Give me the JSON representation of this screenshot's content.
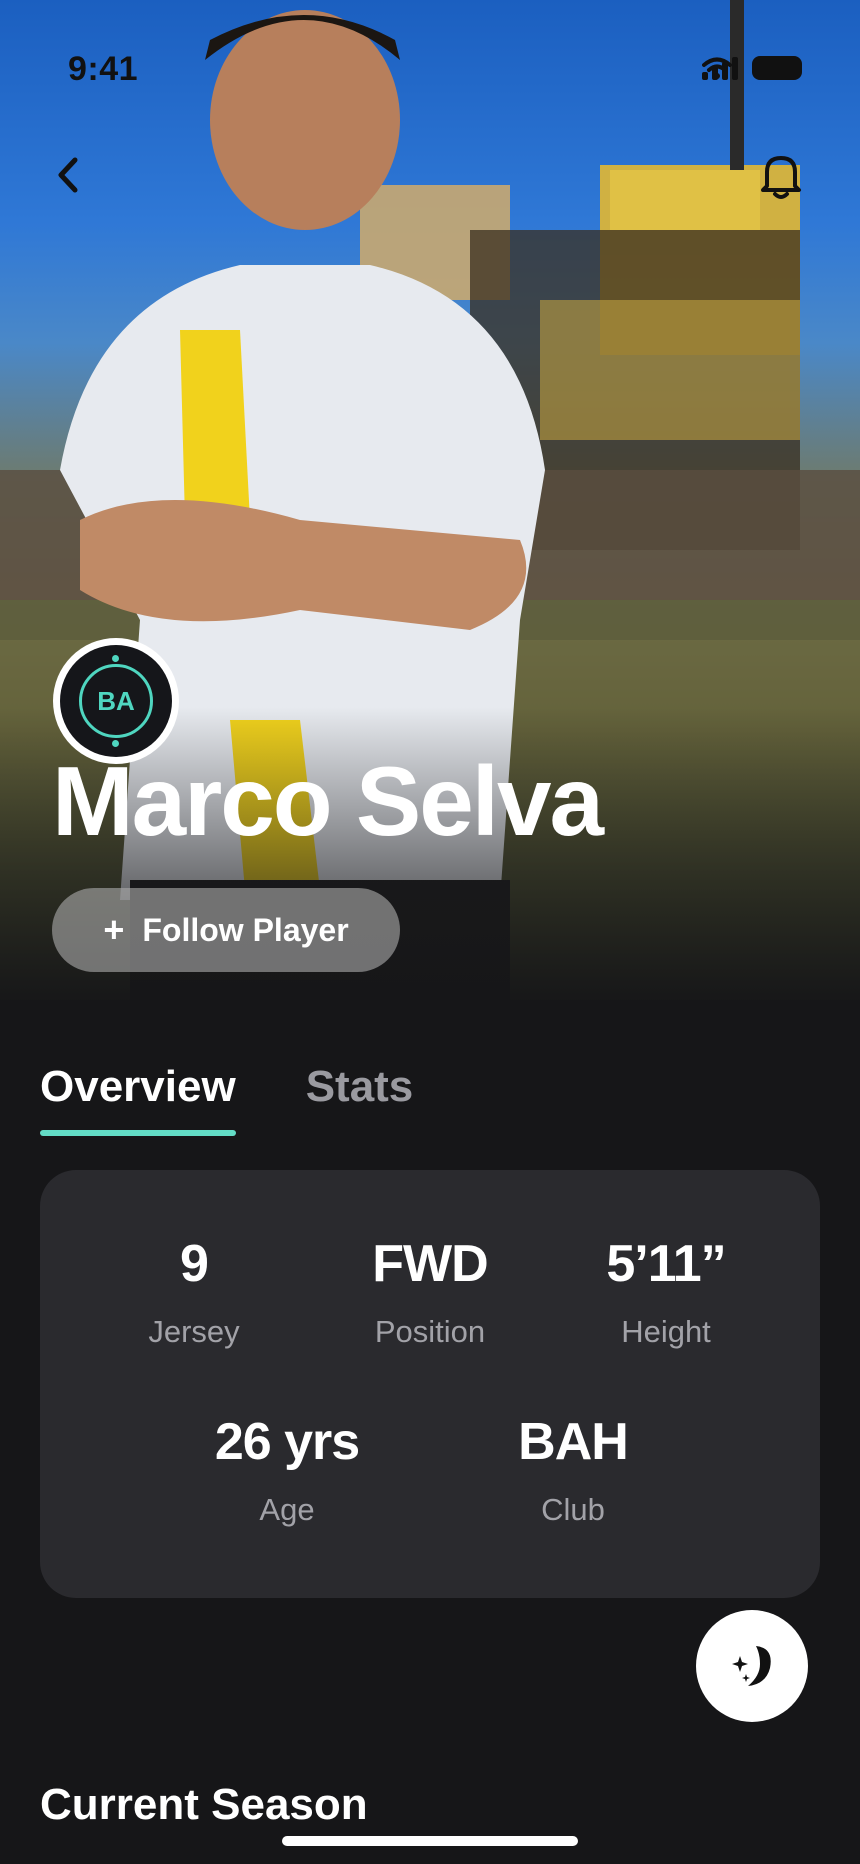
{
  "status_bar": {
    "time": "9:41"
  },
  "player": {
    "avatar_initials": "BA",
    "name": "Marco Selva",
    "follow_label": "Follow Player"
  },
  "tabs": [
    {
      "label": "Overview",
      "active": true
    },
    {
      "label": "Stats",
      "active": false
    }
  ],
  "info_card": {
    "stats": [
      {
        "value": "9",
        "label": "Jersey"
      },
      {
        "value": "FWD",
        "label": "Position"
      },
      {
        "value": "5’11”",
        "label": "Height"
      },
      {
        "value": "26 yrs",
        "label": "Age"
      },
      {
        "value": "BAH",
        "label": "Club"
      }
    ]
  },
  "sections": {
    "current_season": "Current Season"
  },
  "colors": {
    "accent": "#63dcc6",
    "background": "#161618",
    "card": "#2a2a2e"
  },
  "icons": [
    "back-chevron-icon",
    "bell-icon",
    "plus-icon",
    "ai-sparkle-icon"
  ]
}
